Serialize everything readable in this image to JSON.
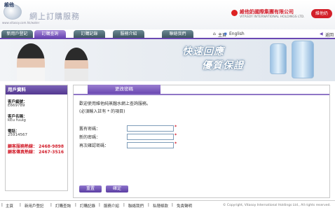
{
  "header": {
    "logo_text": "維他",
    "site_title": "網上訂購服務",
    "site_sub": "www.vitasoy.com.hk/water",
    "corp_zh": "維他奶國際集團有限公司",
    "corp_en": "VITASOY INTERNATIONAL HOLDINGS LTD.",
    "corp_badge": "維他奶"
  },
  "nav": {
    "tabs": [
      "新用戶登記",
      "訂購查詢",
      "訂購記錄",
      "服務介紹",
      "聯絡我們"
    ],
    "home": "主頁",
    "english": "English",
    "back": "返回"
  },
  "banner": {
    "slogan_line1": "快速回應",
    "slogan_line2": "優質保證"
  },
  "sidebar": {
    "title": "用戶資料",
    "customer_no_label": "客戶編號：",
    "customer_no": "E669789",
    "customer_name_label": "客戶名稱：",
    "customer_name": "kEu fuuig",
    "phone_label": "電話：",
    "phone": "25914567",
    "hotline_label": "顧客服務熱線：",
    "hotline": "2468-9898",
    "fax_label": "顧客傳真熱線：",
    "fax": "2467-3516"
  },
  "main": {
    "tab_title": "更改密碼",
    "intro1": "歡迎使用維他純蒸餾水網上查詢服務。",
    "intro2": "(必須輸入註有 * 的項目)",
    "old_pw_label": "舊有密碼：",
    "new_pw_label": "新的密碼：",
    "confirm_pw_label": "再次確認密碼：",
    "required_mark": "*",
    "reset_label": "重置",
    "confirm_label": "確定"
  },
  "footer": {
    "links": [
      "主頁",
      "新用戶登記",
      "訂購查詢",
      "訂購記錄",
      "服務介紹",
      "聯絡我們",
      "私隱條款",
      "免責聲明"
    ],
    "copyright": "© Copyright, Vitasoy International Holdings Ltd., All rights reserved."
  },
  "colors": {
    "accent": "#6a47b2",
    "nav_tab": "#4d6670",
    "hotline": "#d21d2a",
    "brand_red": "#d3202a"
  }
}
